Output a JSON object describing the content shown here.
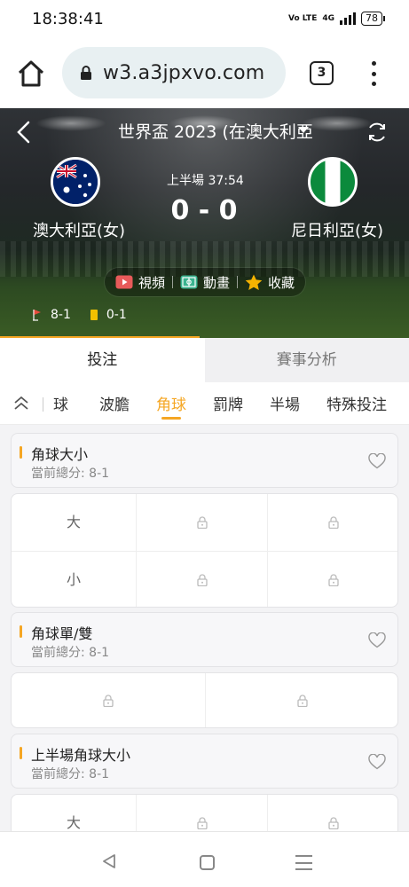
{
  "status": {
    "time": "18:38:41",
    "volte": "Vo LTE",
    "network": "4G",
    "battery": "78"
  },
  "browser": {
    "url": "w3.a3jpxvo.com",
    "tab_count": "3"
  },
  "match": {
    "league": "世界盃 2023 (在澳大利亞",
    "period": "上半場  37:54",
    "score": "0 - 0",
    "home_team": "澳大利亞(女)",
    "away_team": "尼日利亞(女)",
    "actions": [
      {
        "label": "視頻",
        "icon": "video-icon"
      },
      {
        "label": "動畫",
        "icon": "animation-icon"
      },
      {
        "label": "收藏",
        "icon": "star-icon"
      }
    ],
    "corners": "8-1",
    "yellow_cards": "0-1"
  },
  "main_tabs": [
    {
      "label": "投注",
      "active": true
    },
    {
      "label": "賽事分析",
      "active": false
    }
  ],
  "sub_nav": [
    {
      "label": "球",
      "active": false
    },
    {
      "label": "波膽",
      "active": false
    },
    {
      "label": "角球",
      "active": true
    },
    {
      "label": "罰牌",
      "active": false
    },
    {
      "label": "半場",
      "active": false
    },
    {
      "label": "特殊投注",
      "active": false
    }
  ],
  "markets": [
    {
      "title": "角球大小",
      "subtitle": "當前總分: 8-1",
      "rows": [
        "大",
        "小"
      ]
    },
    {
      "title": "角球單/雙",
      "subtitle": "當前總分: 8-1"
    },
    {
      "title": "上半場角球大小",
      "subtitle": "當前總分: 8-1",
      "rows": [
        "大"
      ]
    }
  ],
  "colors": {
    "accent": "#f5a623",
    "inactive_tab_bg": "#f0f0f2"
  }
}
